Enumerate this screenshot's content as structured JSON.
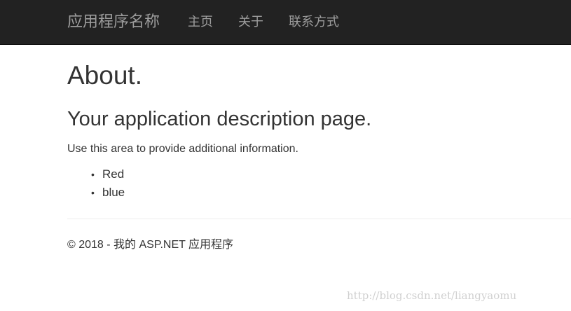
{
  "navbar": {
    "brand": "应用程序名称",
    "links": [
      "主页",
      "关于",
      "联系方式"
    ]
  },
  "main": {
    "title": "About.",
    "subtitle": "Your application description page.",
    "description": "Use this area to provide additional information.",
    "list": [
      "Red",
      "blue"
    ]
  },
  "footer": {
    "text": "© 2018 - 我的 ASP.NET 应用程序"
  },
  "watermark": {
    "text": "http://blog.csdn.net/liangyaomu"
  },
  "colors": {
    "navbar_bg": "#222222",
    "nav_text": "#9d9d9d",
    "body_text": "#333333",
    "divider": "#eeeeee"
  }
}
